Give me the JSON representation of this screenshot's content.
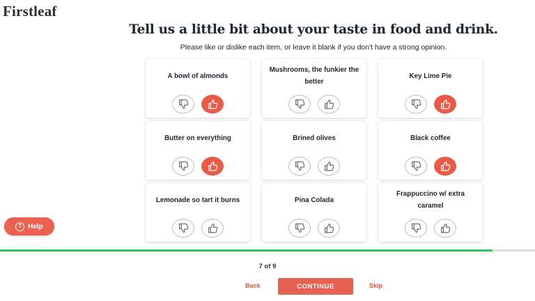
{
  "brand": {
    "logo": "Firstleaf"
  },
  "header": {
    "title": "Tell us a little bit about your taste in food and drink.",
    "subtitle": "Please like or dislike each item, or leave it blank if you don't have a strong opinion."
  },
  "items": [
    {
      "label": "A bowl of almonds",
      "vote": "like"
    },
    {
      "label": "Mushrooms, the funkier the better",
      "vote": "none"
    },
    {
      "label": "Key Lime Pie",
      "vote": "like"
    },
    {
      "label": "Butter on everything",
      "vote": "like"
    },
    {
      "label": "Brined olives",
      "vote": "none"
    },
    {
      "label": "Black coffee",
      "vote": "like"
    },
    {
      "label": "Lemonade so tart it burns",
      "vote": "none"
    },
    {
      "label": "Pina Colada",
      "vote": "none"
    },
    {
      "label": "Frappuccino w/ extra caramel",
      "vote": "none"
    }
  ],
  "icons": {
    "dislike": "thumbs-down-icon",
    "like": "thumbs-up-icon",
    "help": "question-circle-icon"
  },
  "help": {
    "label": "Help"
  },
  "progress": {
    "fraction": 0.92
  },
  "footer": {
    "step": "7 of 9",
    "back_label": "Back",
    "continue_label": "CONTINUE",
    "skip_label": "Skip"
  },
  "colors": {
    "accent": "#ea5a47",
    "progress": "#2ec55a"
  }
}
